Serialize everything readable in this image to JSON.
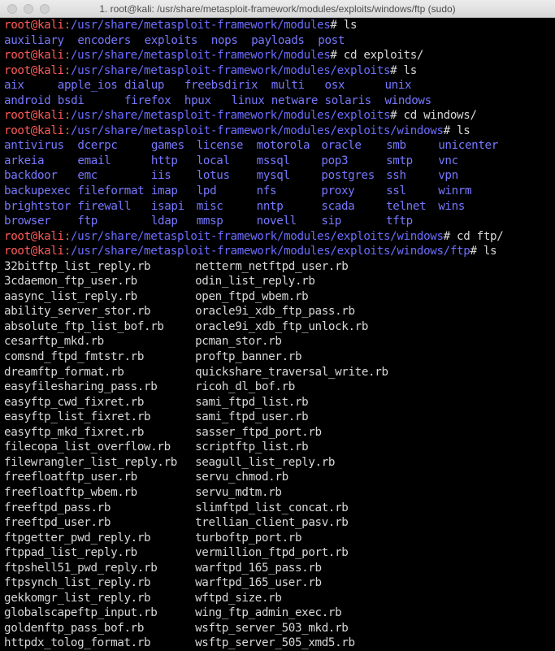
{
  "window": {
    "title": "1. root@kali: /usr/share/metasploit-framework/modules/exploits/windows/ftp (sudo)"
  },
  "colors": {
    "background": "#000000",
    "prompt_user": "#ff5a5a",
    "prompt_path": "#6c6cff",
    "directory": "#7878ff",
    "text": "#d8d8d8"
  },
  "prompt_user": "root@kali",
  "blocks": {
    "p1": {
      "path": "/usr/share/metasploit-framework/modules",
      "cmd": "# ls"
    },
    "modules_ls": [
      "auxiliary",
      "encoders",
      "exploits",
      "nops",
      "payloads",
      "post"
    ],
    "p2": {
      "path": "/usr/share/metasploit-framework/modules",
      "cmd": "# cd exploits/"
    },
    "p3": {
      "path": "/usr/share/metasploit-framework/modules/exploits",
      "cmd": "# ls"
    },
    "exploits_ls": [
      [
        "aix",
        "apple_ios",
        "dialup",
        "freebsd",
        "irix",
        "multi",
        "osx",
        "unix"
      ],
      [
        "android",
        "bsdi",
        "",
        "firefox",
        "hpux",
        "linux",
        "netware",
        "solaris",
        "windows"
      ]
    ],
    "p4": {
      "path": "/usr/share/metasploit-framework/modules/exploits",
      "cmd": "# cd windows/"
    },
    "p5": {
      "path": "/usr/share/metasploit-framework/modules/exploits/windows",
      "cmd": "# ls"
    },
    "windows_ls": [
      [
        "antivirus",
        "dcerpc",
        "games",
        "license",
        "motorola",
        "oracle",
        "smb",
        "unicenter"
      ],
      [
        "arkeia",
        "email",
        "http",
        "local",
        "mssql",
        "pop3",
        "smtp",
        "vnc"
      ],
      [
        "backdoor",
        "emc",
        "iis",
        "lotus",
        "mysql",
        "postgres",
        "ssh",
        "vpn"
      ],
      [
        "backupexec",
        "fileformat",
        "imap",
        "lpd",
        "nfs",
        "proxy",
        "ssl",
        "winrm"
      ],
      [
        "brightstor",
        "firewall",
        "isapi",
        "misc",
        "nntp",
        "scada",
        "telnet",
        "wins"
      ],
      [
        "browser",
        "ftp",
        "ldap",
        "mmsp",
        "novell",
        "sip",
        "tftp",
        ""
      ]
    ],
    "p6": {
      "path": "/usr/share/metasploit-framework/modules/exploits/windows",
      "cmd": "# cd ftp/"
    },
    "p7": {
      "path": "/usr/share/metasploit-framework/modules/exploits/windows/ftp",
      "cmd": "# ls"
    },
    "ftp_ls": [
      [
        "32bitftp_list_reply.rb",
        "netterm_netftpd_user.rb"
      ],
      [
        "3cdaemon_ftp_user.rb",
        "odin_list_reply.rb"
      ],
      [
        "aasync_list_reply.rb",
        "open_ftpd_wbem.rb"
      ],
      [
        "ability_server_stor.rb",
        "oracle9i_xdb_ftp_pass.rb"
      ],
      [
        "absolute_ftp_list_bof.rb",
        "oracle9i_xdb_ftp_unlock.rb"
      ],
      [
        "cesarftp_mkd.rb",
        "pcman_stor.rb"
      ],
      [
        "comsnd_ftpd_fmtstr.rb",
        "proftp_banner.rb"
      ],
      [
        "dreamftp_format.rb",
        "quickshare_traversal_write.rb"
      ],
      [
        "easyfilesharing_pass.rb",
        "ricoh_dl_bof.rb"
      ],
      [
        "easyftp_cwd_fixret.rb",
        "sami_ftpd_list.rb"
      ],
      [
        "easyftp_list_fixret.rb",
        "sami_ftpd_user.rb"
      ],
      [
        "easyftp_mkd_fixret.rb",
        "sasser_ftpd_port.rb"
      ],
      [
        "filecopa_list_overflow.rb",
        "scriptftp_list.rb"
      ],
      [
        "filewrangler_list_reply.rb",
        "seagull_list_reply.rb"
      ],
      [
        "freefloatftp_user.rb",
        "servu_chmod.rb"
      ],
      [
        "freefloatftp_wbem.rb",
        "servu_mdtm.rb"
      ],
      [
        "freeftpd_pass.rb",
        "slimftpd_list_concat.rb"
      ],
      [
        "freeftpd_user.rb",
        "trellian_client_pasv.rb"
      ],
      [
        "ftpgetter_pwd_reply.rb",
        "turboftp_port.rb"
      ],
      [
        "ftppad_list_reply.rb",
        "vermillion_ftpd_port.rb"
      ],
      [
        "ftpshell51_pwd_reply.rb",
        "warftpd_165_pass.rb"
      ],
      [
        "ftpsynch_list_reply.rb",
        "warftpd_165_user.rb"
      ],
      [
        "gekkomgr_list_reply.rb",
        "wftpd_size.rb"
      ],
      [
        "globalscapeftp_input.rb",
        "wing_ftp_admin_exec.rb"
      ],
      [
        "goldenftp_pass_bof.rb",
        "wsftp_server_503_mkd.rb"
      ],
      [
        "httpdx_tolog_format.rb",
        "wsftp_server_505_xmd5.rb"
      ]
    ]
  }
}
